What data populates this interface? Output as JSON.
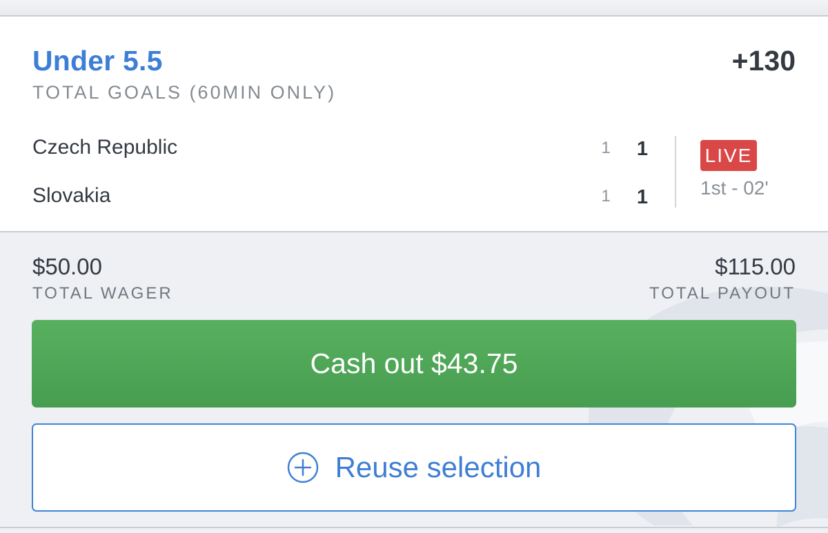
{
  "bet": {
    "selection": "Under 5.5",
    "odds": "+130",
    "market": "TOTAL GOALS (60MIN ONLY)"
  },
  "match": {
    "teams": [
      {
        "name": "Czech Republic",
        "period_score": "1",
        "total_score": "1"
      },
      {
        "name": "Slovakia",
        "period_score": "1",
        "total_score": "1"
      }
    ],
    "status_badge": "LIVE",
    "clock": "1st - 02'"
  },
  "summary": {
    "wager_amount": "$50.00",
    "wager_label": "TOTAL WAGER",
    "payout_amount": "$115.00",
    "payout_label": "TOTAL PAYOUT"
  },
  "actions": {
    "cashout_label": "Cash out $43.75",
    "reuse_label": "Reuse selection"
  },
  "colors": {
    "selection_blue": "#3d7fd6",
    "live_red": "#d94747",
    "cashout_green": "#4fa857",
    "outline_blue": "#3f84d8"
  },
  "icons": {
    "reuse": "plus-circle-icon",
    "background": "brand-watermark-icon"
  }
}
